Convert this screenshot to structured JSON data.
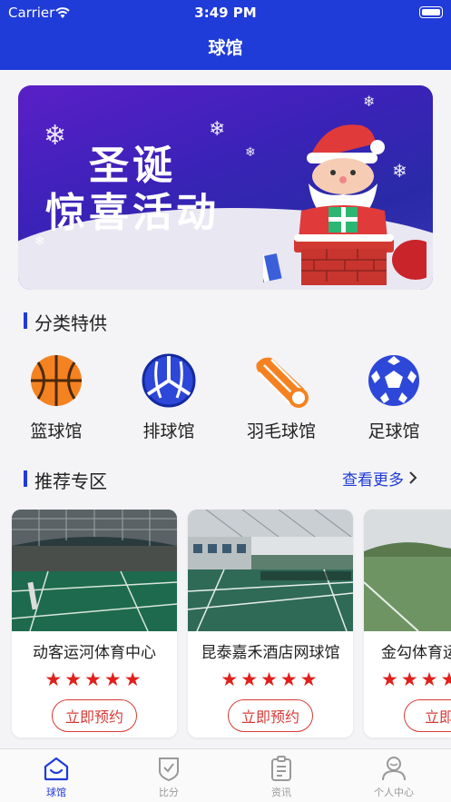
{
  "status_bar": {
    "carrier": "Carrier",
    "time": "3:49 PM"
  },
  "nav": {
    "title": "球馆"
  },
  "banner": {
    "line1": "圣诞",
    "line2": "惊喜活动"
  },
  "categories_section": {
    "title": "分类特供"
  },
  "categories": [
    {
      "label": "篮球馆",
      "icon": "basketball-icon"
    },
    {
      "label": "排球馆",
      "icon": "volleyball-icon"
    },
    {
      "label": "羽毛球馆",
      "icon": "shuttlecock-icon"
    },
    {
      "label": "足球馆",
      "icon": "football-icon"
    }
  ],
  "recommend_section": {
    "title": "推荐专区",
    "more": "查看更多"
  },
  "venues": [
    {
      "name": "动客运河体育中心",
      "rating": 5,
      "stars": "★★★★★",
      "button": "立即预约"
    },
    {
      "name": "昆泰嘉禾酒店网球馆",
      "rating": 5,
      "stars": "★★★★★",
      "button": "立即预约"
    },
    {
      "name": "金勾体育运",
      "rating": 5,
      "stars": "★★★★★",
      "button": "立即预"
    }
  ],
  "tabs": [
    {
      "label": "球馆",
      "icon": "home-icon",
      "active": true
    },
    {
      "label": "比分",
      "icon": "shield-check-icon",
      "active": false
    },
    {
      "label": "资讯",
      "icon": "clipboard-icon",
      "active": false
    },
    {
      "label": "个人中心",
      "icon": "user-icon",
      "active": false
    }
  ],
  "colors": {
    "primary": "#1f3bd8",
    "accent_orange": "#f58220",
    "star_red": "#e0201c"
  }
}
